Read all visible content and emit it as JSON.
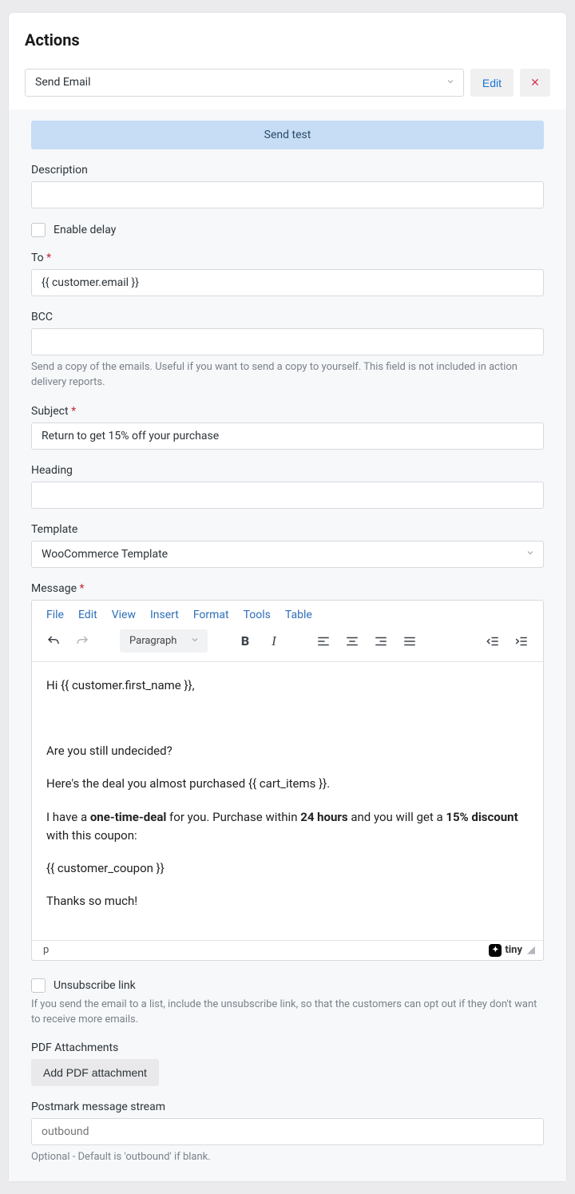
{
  "title": "Actions",
  "action_select": "Send Email",
  "buttons": {
    "edit": "Edit",
    "sendtest": "Send test",
    "addpdf": "Add PDF attachment"
  },
  "labels": {
    "description": "Description",
    "enable_delay": "Enable delay",
    "to": "To",
    "bcc": "BCC",
    "subject": "Subject",
    "heading": "Heading",
    "template": "Template",
    "message": "Message",
    "unsubscribe": "Unsubscribe link",
    "pdf": "PDF Attachments",
    "postmark": "Postmark message stream"
  },
  "values": {
    "description": "",
    "to": "{{ customer.email }}",
    "bcc": "",
    "subject": "Return to get 15% off your purchase",
    "heading": "",
    "template": "WooCommerce Template",
    "postmark": "",
    "postmark_placeholder": "outbound"
  },
  "help": {
    "bcc": "Send a copy of the emails. Useful if you want to send a copy to yourself. This field is not included in action delivery reports.",
    "unsubscribe": "If you send the email to a list, include the unsubscribe link, so that the customers can opt out if they don't want to receive more emails.",
    "postmark": "Optional - Default is 'outbound' if blank."
  },
  "editor": {
    "menus": [
      "File",
      "Edit",
      "View",
      "Insert",
      "Format",
      "Tools",
      "Table"
    ],
    "para_label": "Paragraph",
    "status_path": "p",
    "brand": "tiny",
    "body": {
      "l1a": "Hi ",
      "l1b": "{{ customer.first_name }}",
      "l1c": ",",
      "l2": " ",
      "l3": "Are you still undecided?",
      "l4a": "Here's the deal you almost purchased ",
      "l4b": "{{ cart_items }}",
      "l4c": ".",
      "l5a": "I have a ",
      "l5b": "one-time-deal",
      "l5c": " for you. Purchase within ",
      "l5d": "24 hours",
      "l5e": " and you will get a ",
      "l5f": "15% discount",
      "l5g": " with this coupon:",
      "l6": "{{ customer_coupon }}",
      "l7": "Thanks so much!"
    }
  }
}
